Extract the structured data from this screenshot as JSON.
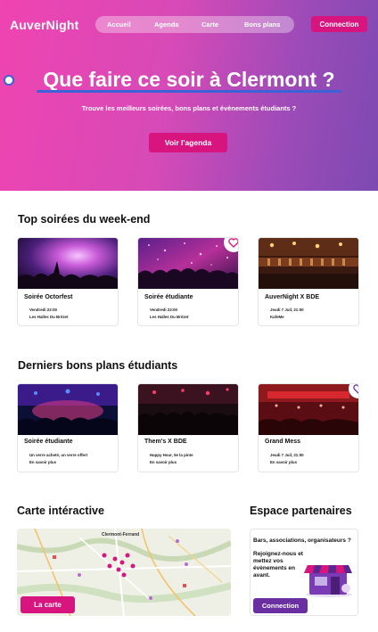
{
  "header": {
    "brand": "AuverNight",
    "nav": [
      "Accueil",
      "Agenda",
      "Carte",
      "Bons plans"
    ],
    "login_label": "Connection"
  },
  "hero": {
    "title": "Que faire ce soir à Clermont ?",
    "subtitle": "Trouve les meilleurs soirées, bons plans et évènements étudiants ?",
    "cta_label": "Voir l'agenda"
  },
  "weekend": {
    "title": "Top soirées du week-end",
    "cards": [
      {
        "title": "Soirée Octorfest",
        "line1": "Vendredi 22:00",
        "line2": "Les Halles Du Brézet"
      },
      {
        "title": "Soirée étudiante",
        "line1": "Vendredi 23:00",
        "line2": "Les Halles Du Brézet"
      },
      {
        "title": "AuverNight X BDE",
        "line1": "Jeudi 7 Juil, 21:00",
        "line2": "KafeMe"
      }
    ]
  },
  "deals": {
    "title": "Derniers bons plans étudiants",
    "cards": [
      {
        "title": "Soirée étudiante",
        "line1": "Un verre acheté, un verre offert",
        "line2": "En savoir plus"
      },
      {
        "title": "Them's X BDE",
        "line1": "Happy Hour, 5e la pinte",
        "line2": "En savoir plus"
      },
      {
        "title": "Grand Mess",
        "line1": "Jeudi 7 Juil, 21:00",
        "line2": "En savoir plus"
      }
    ]
  },
  "map": {
    "title": "Carte intéractive",
    "city_label": "Clermont-Ferrand",
    "button_label": "La carte"
  },
  "partners": {
    "title": "Espace partenaires",
    "headline": "Bars, associations, organisateurs ?",
    "body": [
      "Rejoignez-nous et",
      "mettez vos",
      "évènements en",
      "avant."
    ],
    "button_label": "Connection"
  },
  "colors": {
    "brand_pink": "#d8157f",
    "gradient_start": "#ef44b1",
    "gradient_end": "#7d4ab2",
    "partner_purple": "#6a2fa0",
    "heart_pink": "#d8157f",
    "heart_purple": "#6a2fa0"
  },
  "icons": [
    "heart-icon",
    "storefront-icon",
    "map-pin-icon"
  ]
}
